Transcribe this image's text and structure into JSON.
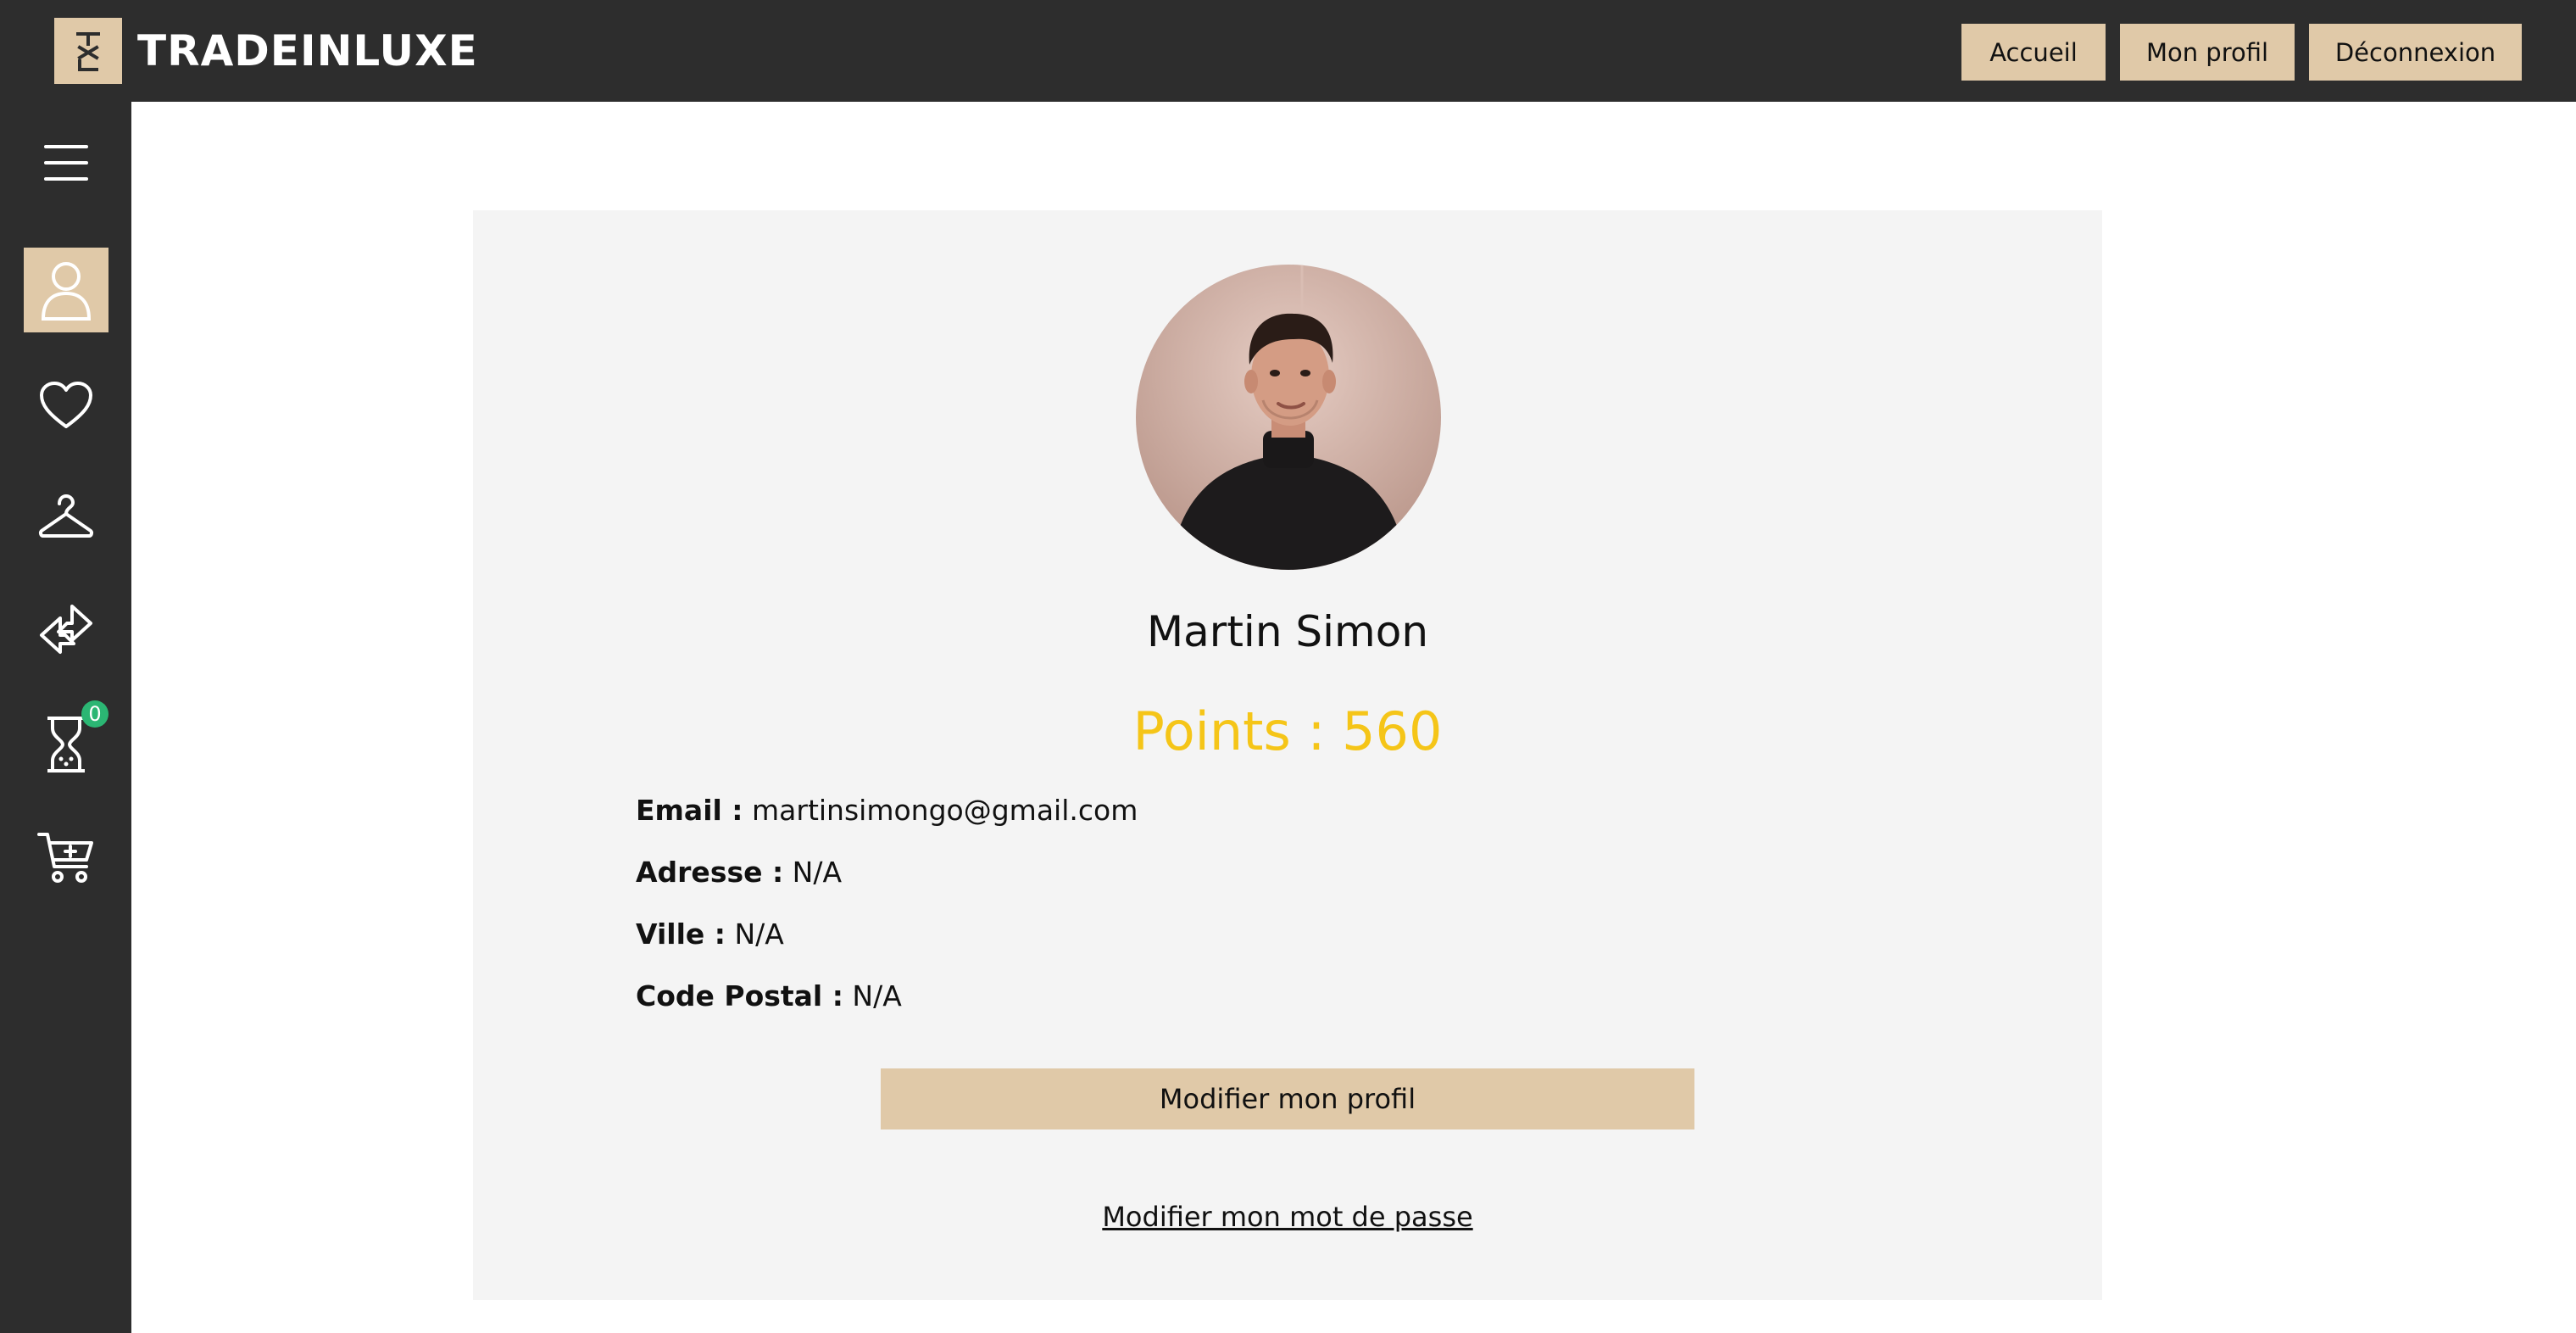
{
  "header": {
    "brand": "TRADEINLUXE",
    "logo_monogram": "TXL",
    "nav": {
      "home": "Accueil",
      "profile": "Mon profil",
      "logout": "Déconnexion"
    }
  },
  "sidebar": {
    "items": [
      {
        "icon": "menu-icon"
      },
      {
        "icon": "user-icon",
        "active": true
      },
      {
        "icon": "heart-icon"
      },
      {
        "icon": "hanger-icon"
      },
      {
        "icon": "exchange-icon"
      },
      {
        "icon": "hourglass-icon",
        "badge": "0"
      },
      {
        "icon": "cart-add-icon"
      }
    ]
  },
  "profile": {
    "name": "Martin Simon",
    "points": "Points : 560",
    "fields": {
      "email_label": "Email :",
      "email_value": "martinsimongo@gmail.com",
      "address_label": "Adresse :",
      "address_value": "N/A",
      "city_label": "Ville :",
      "city_value": "N/A",
      "postal_label": "Code Postal :",
      "postal_value": "N/A"
    },
    "edit_button": "Modifier mon profil",
    "password_link": "Modifier mon mot de passe"
  },
  "colors": {
    "dark": "#2d2d2d",
    "accent": "#e0c9a8",
    "points": "#f5c518",
    "card_bg": "#f4f4f4",
    "badge": "#2bb673"
  }
}
